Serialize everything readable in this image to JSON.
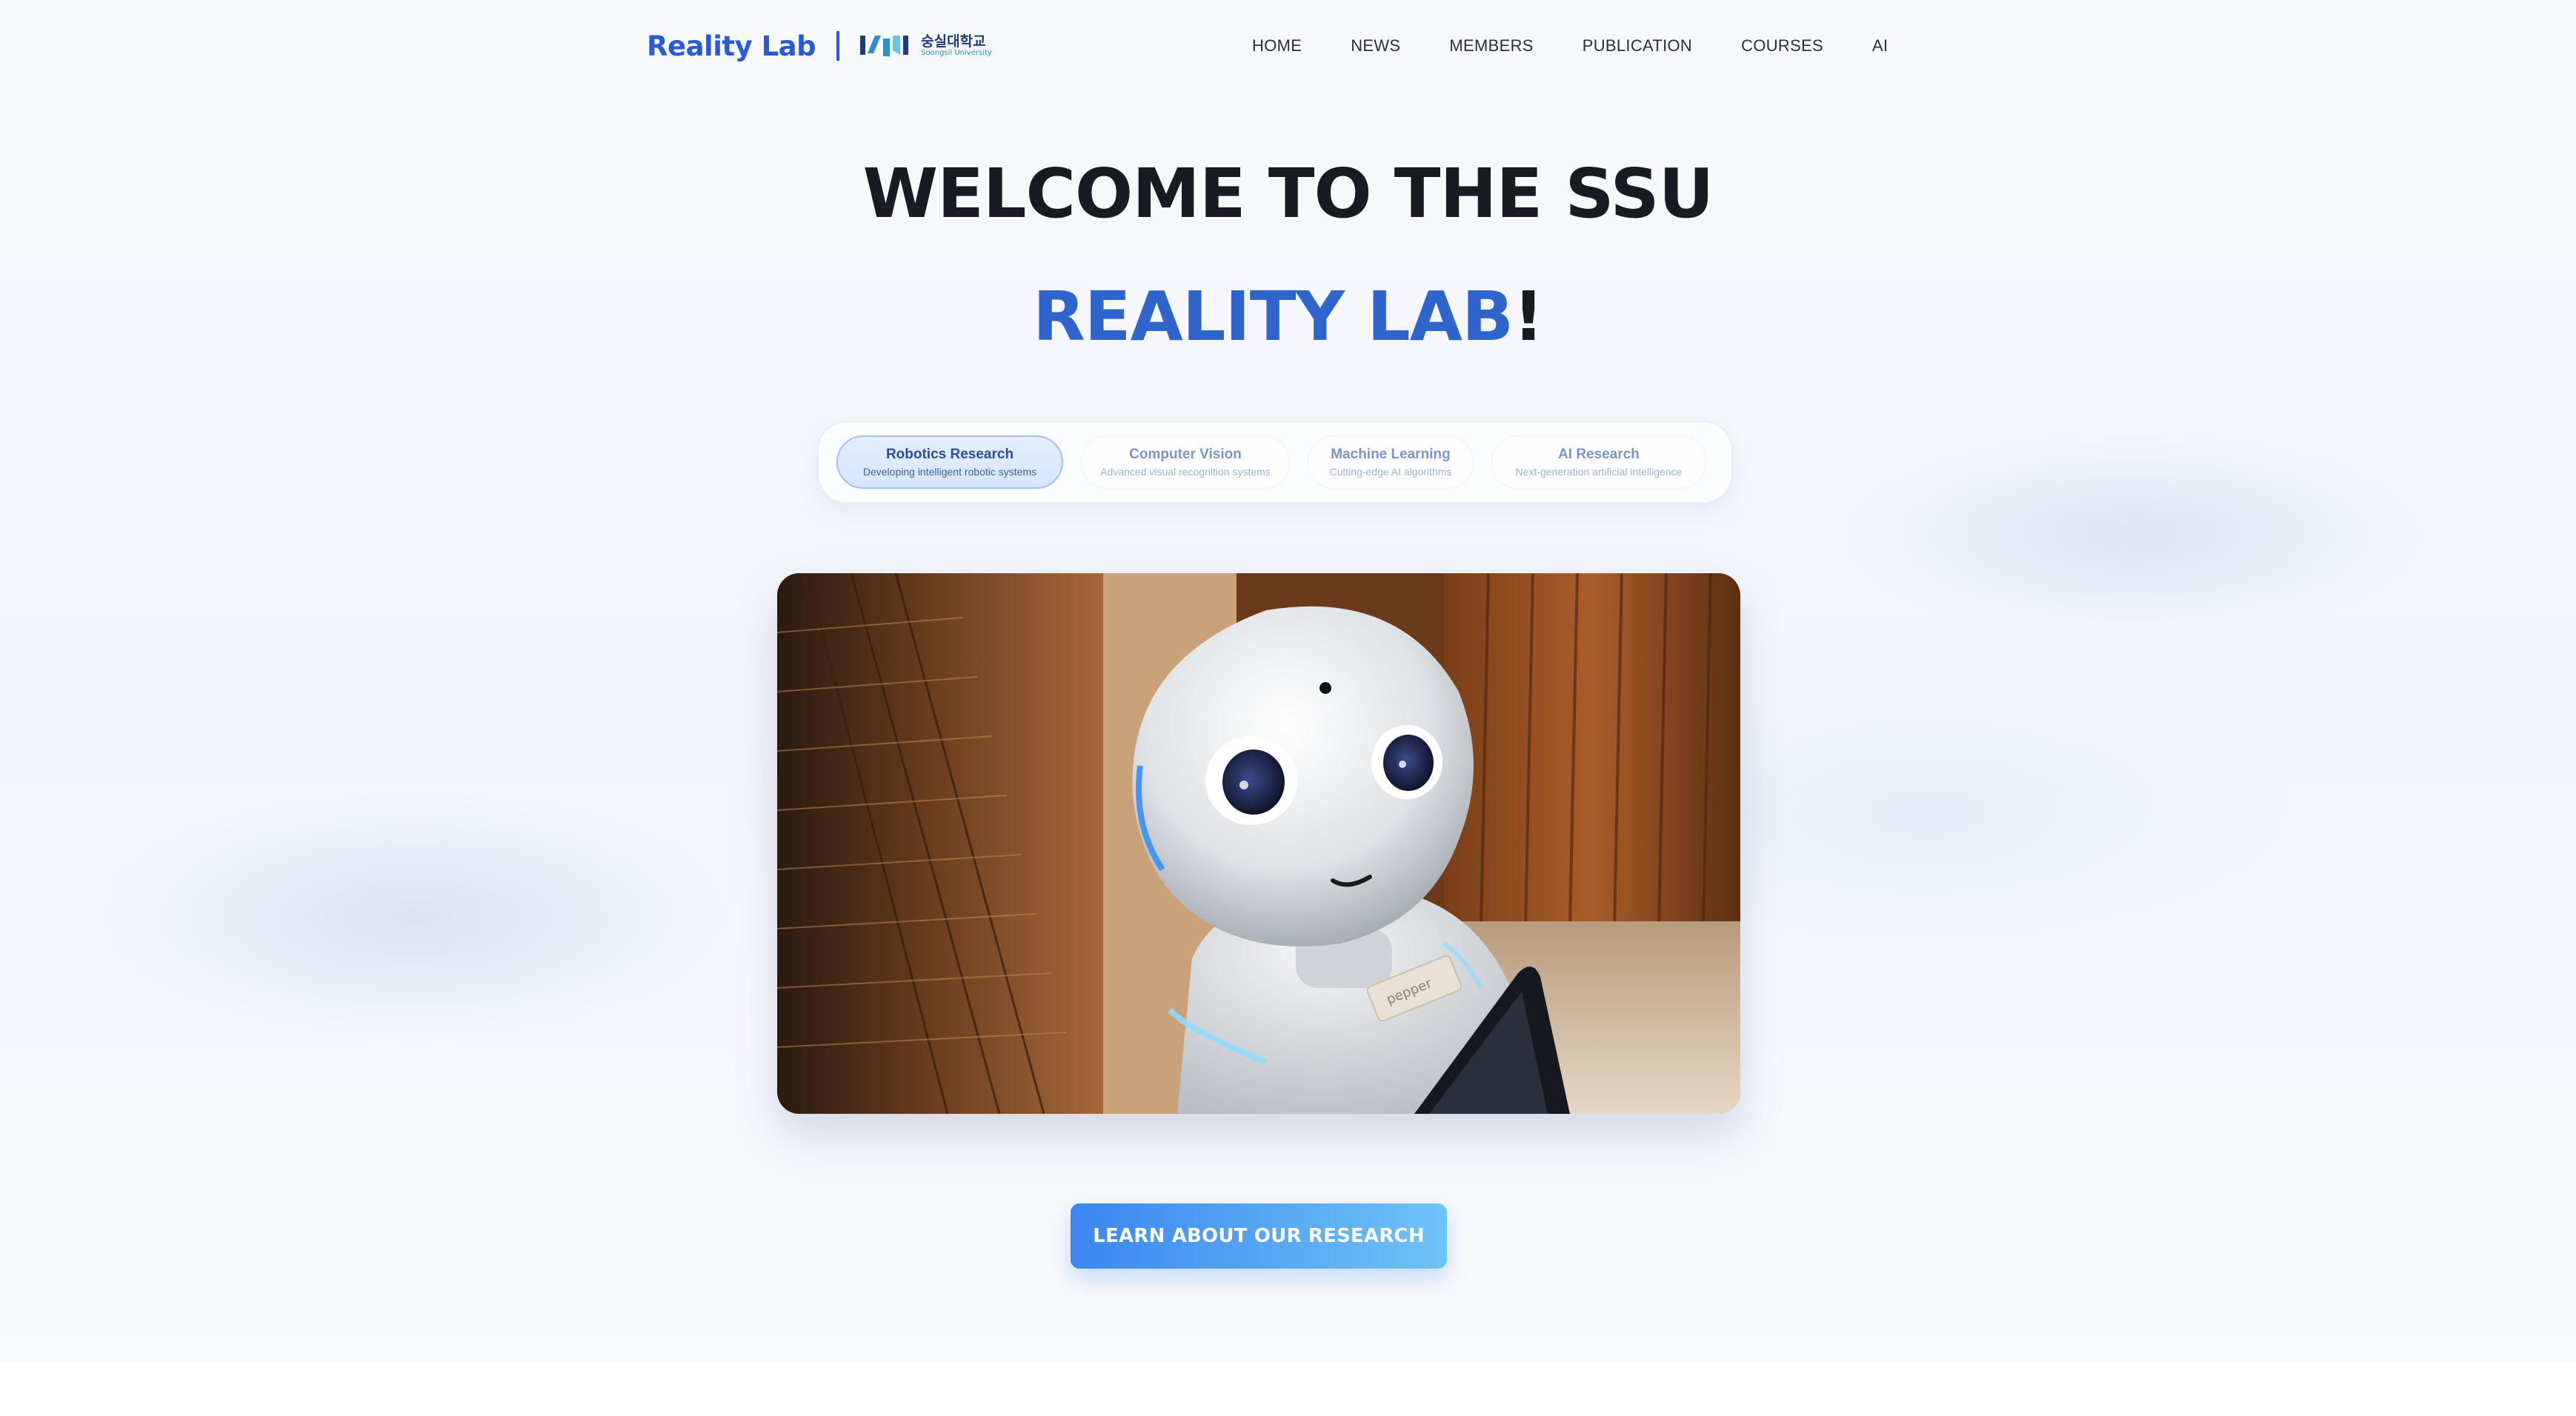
{
  "header": {
    "brand_name": "Reality Lab",
    "university_logo": {
      "korean": "숭실대학교",
      "english": "Soongsil University"
    },
    "nav": [
      "HOME",
      "NEWS",
      "MEMBERS",
      "PUBLICATION",
      "COURSES",
      "AI"
    ]
  },
  "hero": {
    "line1": "WELCOME TO THE SSU",
    "line2_accent": "REALITY LAB",
    "line2_end": "!"
  },
  "tabs": [
    {
      "title": "Robotics Research",
      "subtitle": "Developing intelligent robotic systems",
      "active": true
    },
    {
      "title": "Computer Vision",
      "subtitle": "Advanced visual recognition systems",
      "active": false
    },
    {
      "title": "Machine Learning",
      "subtitle": "Cutting-edge AI algorithms",
      "active": false
    },
    {
      "title": "AI Research",
      "subtitle": "Next-generation artificial intelligence",
      "active": false
    }
  ],
  "hero_image": {
    "subject": "humanoid-robot-photo",
    "badge_text": "pepper"
  },
  "cta": {
    "label": "LEARN ABOUT OUR RESEARCH"
  },
  "colors": {
    "accent": "#2f64cc",
    "brand": "#2a5bd7",
    "cta_start": "#3a86f0",
    "cta_end": "#6fc3f7",
    "heading": "#181b21"
  }
}
